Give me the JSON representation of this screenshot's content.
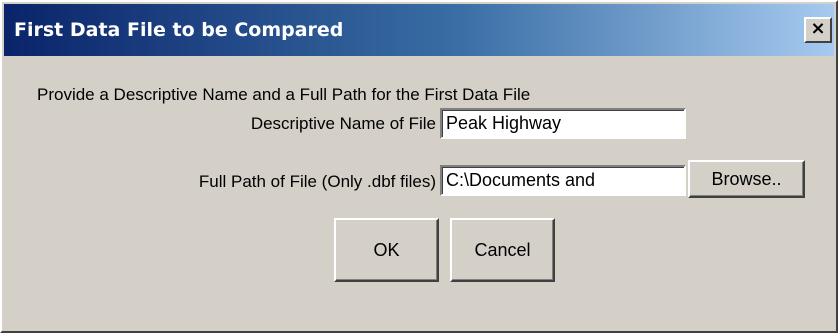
{
  "window": {
    "title": "First Data File to be Compared",
    "close_glyph": "×"
  },
  "dialog": {
    "prompt": "Provide a Descriptive Name and a Full Path for the First Data File",
    "name_label": "Descriptive Name of File",
    "name_value": "Peak Highway",
    "path_label": "Full Path of File (Only .dbf files)",
    "path_value": "C:\\Documents and",
    "browse_label": "Browse..",
    "ok_label": "OK",
    "cancel_label": "Cancel"
  },
  "colors": {
    "titlebar_start": "#0a246a",
    "titlebar_end": "#a6caf0",
    "face": "#d4d0c8"
  },
  "icons": {
    "close": "close-icon"
  }
}
